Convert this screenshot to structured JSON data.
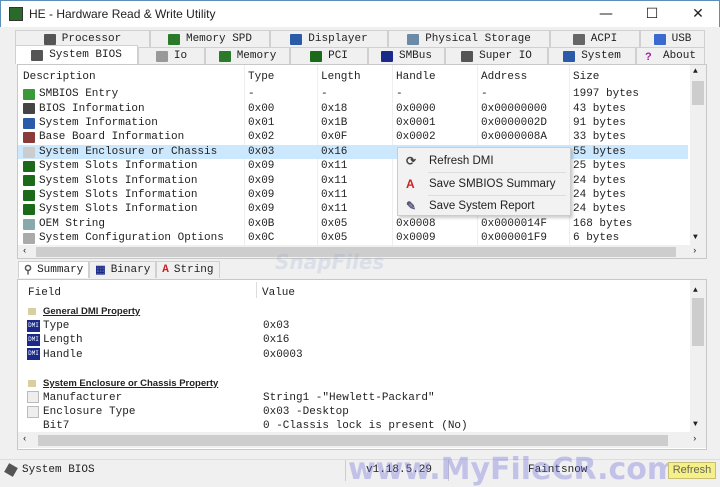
{
  "window": {
    "title": "HE - Hardware Read & Write Utility",
    "minimize": "—",
    "maximize": "☐",
    "close": "✕"
  },
  "tabs_row1": [
    {
      "label": "Processor",
      "icon": "processor-icon",
      "color": "#555"
    },
    {
      "label": "Memory SPD",
      "icon": "memory-spd-icon",
      "color": "#2a7a2a"
    },
    {
      "label": "Displayer",
      "icon": "display-icon",
      "color": "#2a5aa8"
    },
    {
      "label": "Physical Storage",
      "icon": "storage-icon",
      "color": "#6a8aa8"
    },
    {
      "label": "ACPI",
      "icon": "acpi-icon",
      "color": "#666"
    },
    {
      "label": "USB",
      "icon": "usb-icon",
      "color": "#3a6ad0"
    }
  ],
  "tabs_row2": [
    {
      "label": "System BIOS",
      "icon": "chip-icon",
      "color": "#555"
    },
    {
      "label": "Io",
      "icon": "io-icon",
      "color": "#999"
    },
    {
      "label": "Memory",
      "icon": "memory-icon",
      "color": "#2a7a2a"
    },
    {
      "label": "PCI",
      "icon": "pci-icon",
      "color": "#1a6a1a"
    },
    {
      "label": "SMBus",
      "icon": "smbus-icon",
      "color": "#1a2a8a"
    },
    {
      "label": "Super IO",
      "icon": "super-io-icon",
      "color": "#555"
    },
    {
      "label": "System",
      "icon": "system-icon",
      "color": "#2a5aa8"
    },
    {
      "label": "About",
      "icon": "question-icon",
      "color": "#a020a0"
    }
  ],
  "active_tab": "System BIOS",
  "table": {
    "columns": [
      "Description",
      "Type",
      "Length",
      "Handle",
      "Address",
      "Size"
    ],
    "rows": [
      [
        "SMBIOS Entry",
        "-",
        "-",
        "-",
        "-",
        "1997 bytes"
      ],
      [
        "BIOS Information",
        "0x00",
        "0x18",
        "0x0000",
        "0x00000000",
        "43 bytes"
      ],
      [
        "System Information",
        "0x01",
        "0x1B",
        "0x0001",
        "0x0000002D",
        "91 bytes"
      ],
      [
        "Base Board Information",
        "0x02",
        "0x0F",
        "0x0002",
        "0x0000008A",
        "33 bytes"
      ],
      [
        "System Enclosure or Chassis",
        "0x03",
        "0x16",
        "",
        "",
        "55 bytes"
      ],
      [
        "System Slots Information",
        "0x09",
        "0x11",
        "",
        "",
        "25 bytes"
      ],
      [
        "System Slots Information",
        "0x09",
        "0x11",
        "",
        "",
        "24 bytes"
      ],
      [
        "System Slots Information",
        "0x09",
        "0x11",
        "",
        "",
        "24 bytes"
      ],
      [
        "System Slots Information",
        "0x09",
        "0x11",
        "",
        "",
        "24 bytes"
      ],
      [
        "OEM String",
        "0x0B",
        "0x05",
        "0x0008",
        "0x0000014F",
        "168 bytes"
      ],
      [
        "System Configuration Options",
        "0x0C",
        "0x05",
        "0x0009",
        "0x000001F9",
        "6 bytes"
      ]
    ],
    "row_icon_colors": [
      "#3a9a3a",
      "#444",
      "#2a5aa8",
      "#8a3a3a",
      "#ccc",
      "#1a6a1a",
      "#1a6a1a",
      "#1a6a1a",
      "#1a6a1a",
      "#8aa",
      "#aaa"
    ],
    "selected_row": 4
  },
  "context_menu": [
    {
      "label": "Refresh DMI",
      "icon": "refresh-icon"
    },
    {
      "label": "Save SMBIOS Summary",
      "icon": "pdf-icon"
    },
    {
      "label": "Save System Report",
      "icon": "report-icon"
    }
  ],
  "detail_tabs": [
    {
      "label": "Summary",
      "icon": "magnifier-icon"
    },
    {
      "label": "Binary",
      "icon": "binary-icon"
    },
    {
      "label": "String",
      "icon": "string-icon"
    }
  ],
  "detail": {
    "columns": [
      "Field",
      "Value"
    ],
    "sections": [
      {
        "title": "General DMI Property",
        "rows": [
          [
            "Type",
            "0x03"
          ],
          [
            "Length",
            "0x16"
          ],
          [
            "Handle",
            "0x0003"
          ]
        ]
      },
      {
        "title": "System Enclosure or Chassis Property",
        "rows": [
          [
            "Manufacturer",
            "String1 -\"Hewlett-Packard\""
          ],
          [
            "Enclosure Type",
            "0x03 -Desktop"
          ],
          [
            "Bit7",
            "0 -Classis lock is present (No)"
          ]
        ]
      }
    ]
  },
  "status": {
    "section": "System BIOS",
    "version": "v1.18.5.29",
    "author": "Faintsnow",
    "refresh": "Refresh"
  },
  "watermarks": [
    "SnapFiles",
    "www.MyFileCR.com"
  ],
  "colors": {
    "selection": "#cce8ff",
    "accent": "#1a2a8a",
    "refresh_button": "#f5f08a"
  }
}
